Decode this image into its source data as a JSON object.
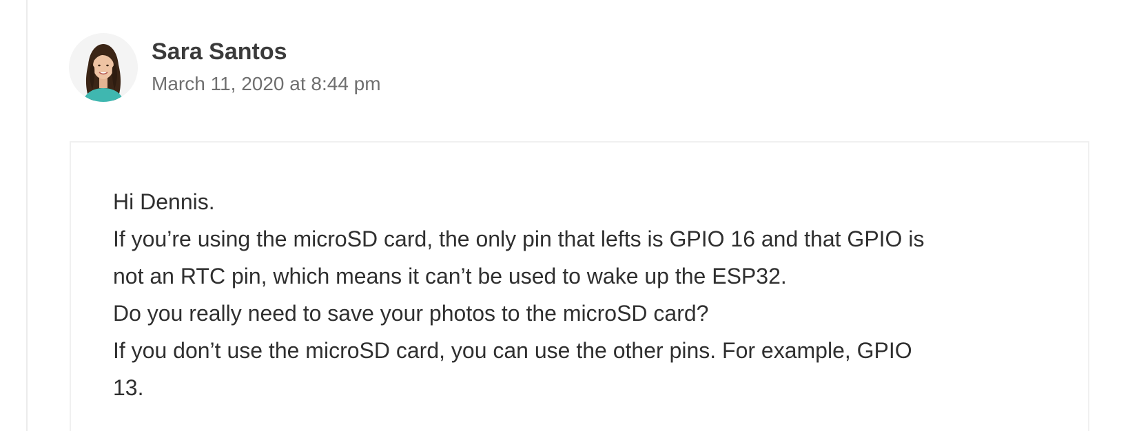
{
  "comment": {
    "author": "Sara Santos",
    "timestamp": "March 11, 2020 at 8:44 pm",
    "avatar_alt": "Sara Santos avatar",
    "body_lines": [
      "Hi Dennis.",
      "If you’re using the microSD card, the only pin that lefts is GPIO 16 and that GPIO is",
      "not an RTC pin, which means it can’t be used to wake up the ESP32.",
      "Do you really need to save your photos to the microSD card?",
      "If you don’t use the microSD card, you can use the other pins. For example, GPIO",
      "13."
    ]
  },
  "colors": {
    "author_text": "#3a3a3a",
    "timestamp_text": "#6f6f6f",
    "body_text": "#2f2f2f",
    "box_border": "#f0f0f0",
    "thread_line": "#ececec"
  }
}
